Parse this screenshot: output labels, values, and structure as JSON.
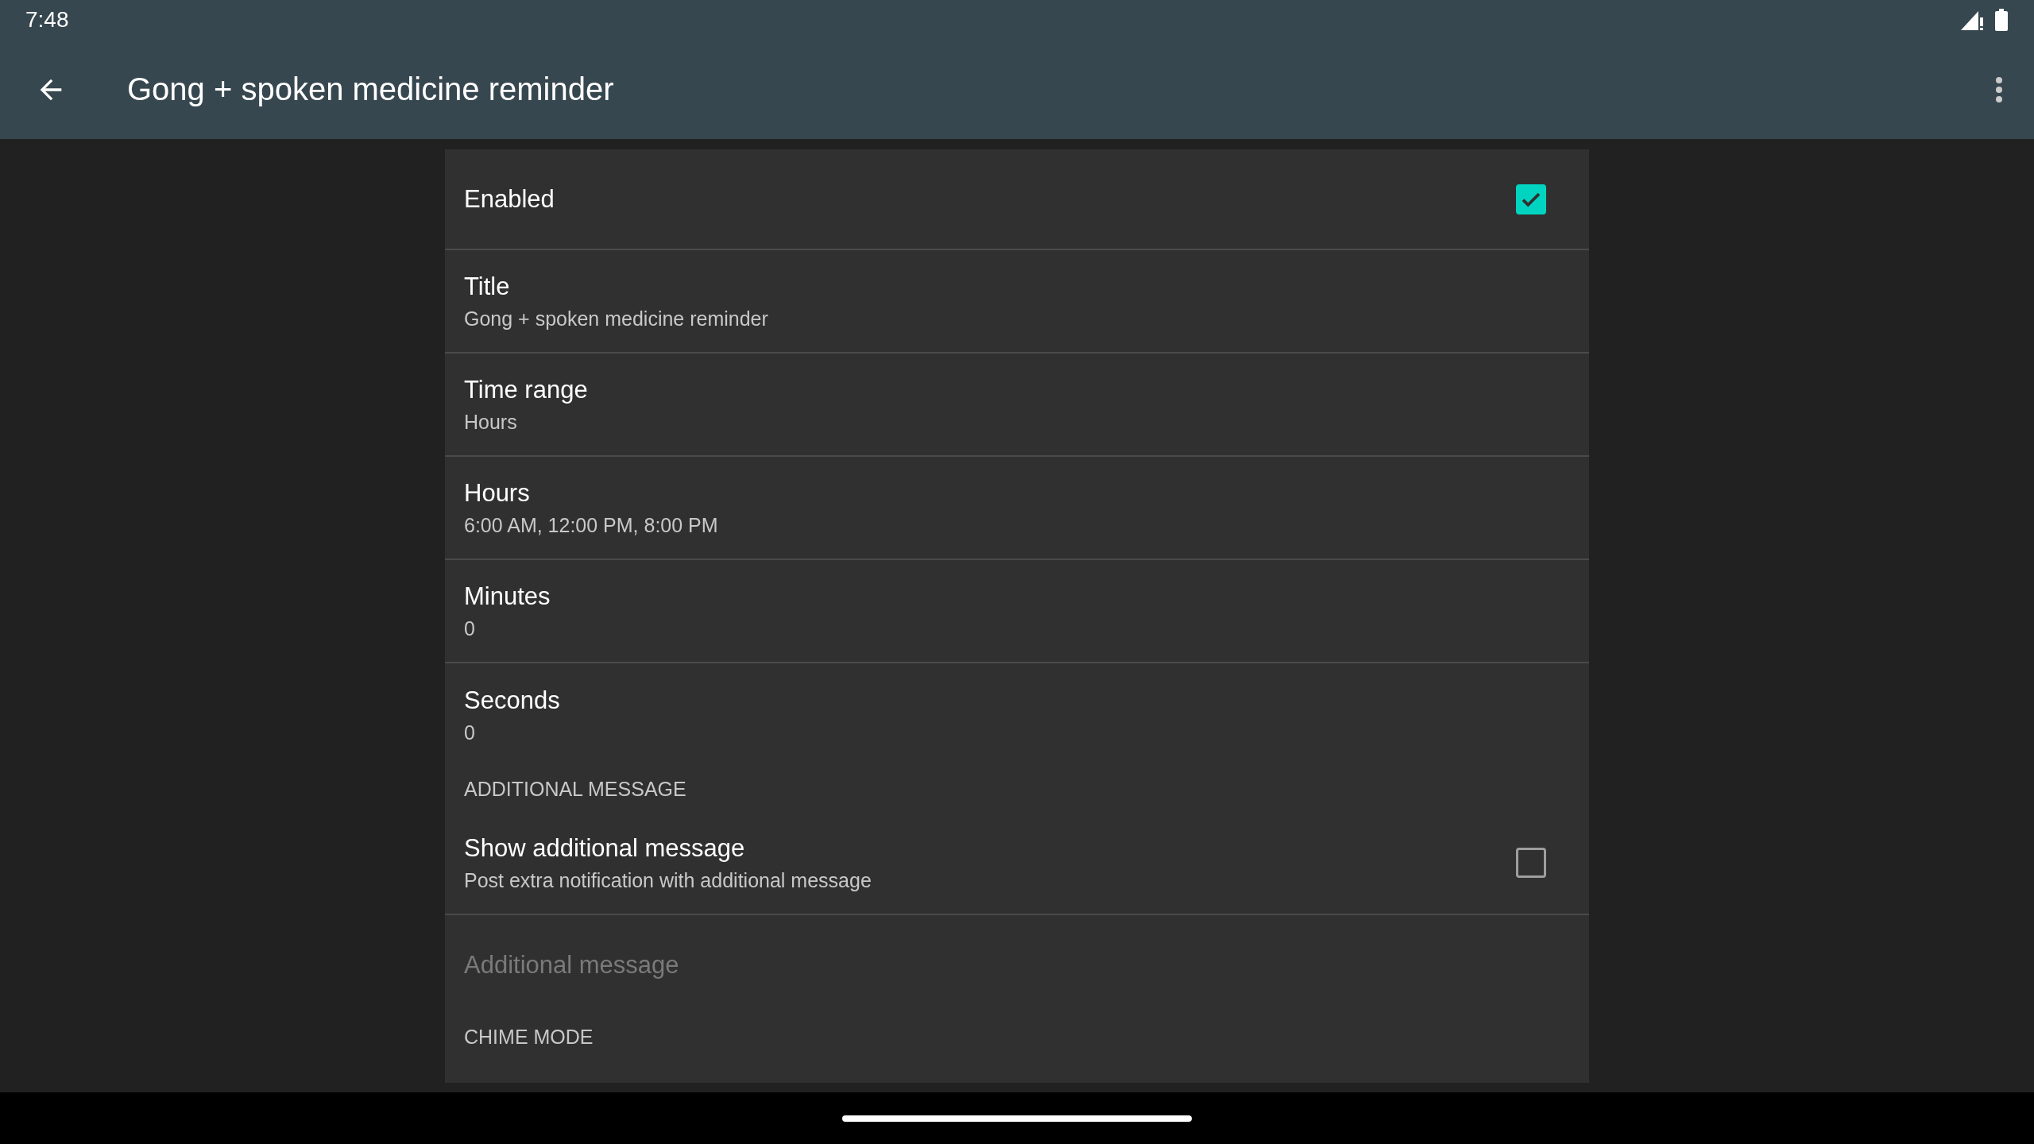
{
  "status_bar": {
    "time": "7:48"
  },
  "app_bar": {
    "title": "Gong + spoken medicine reminder"
  },
  "preferences": [
    {
      "kind": "checkbox",
      "title": "Enabled",
      "checked": true,
      "divider": true
    },
    {
      "kind": "text",
      "title": "Title",
      "summary": "Gong + spoken medicine reminder",
      "divider": true
    },
    {
      "kind": "text",
      "title": "Time range",
      "summary": "Hours",
      "divider": true
    },
    {
      "kind": "text",
      "title": "Hours",
      "summary": "6:00 AM, 12:00 PM, 8:00 PM",
      "divider": true
    },
    {
      "kind": "text",
      "title": "Minutes",
      "summary": "0",
      "divider": true
    },
    {
      "kind": "text",
      "title": "Seconds",
      "summary": "0",
      "divider": false
    },
    {
      "kind": "header",
      "title": "ADDITIONAL MESSAGE"
    },
    {
      "kind": "checkbox",
      "title": "Show additional message",
      "summary": "Post extra notification with additional message",
      "checked": false,
      "divider": true
    },
    {
      "kind": "text",
      "title": "Additional message",
      "disabled": true,
      "divider": false
    },
    {
      "kind": "header",
      "title": "CHIME MODE"
    }
  ]
}
